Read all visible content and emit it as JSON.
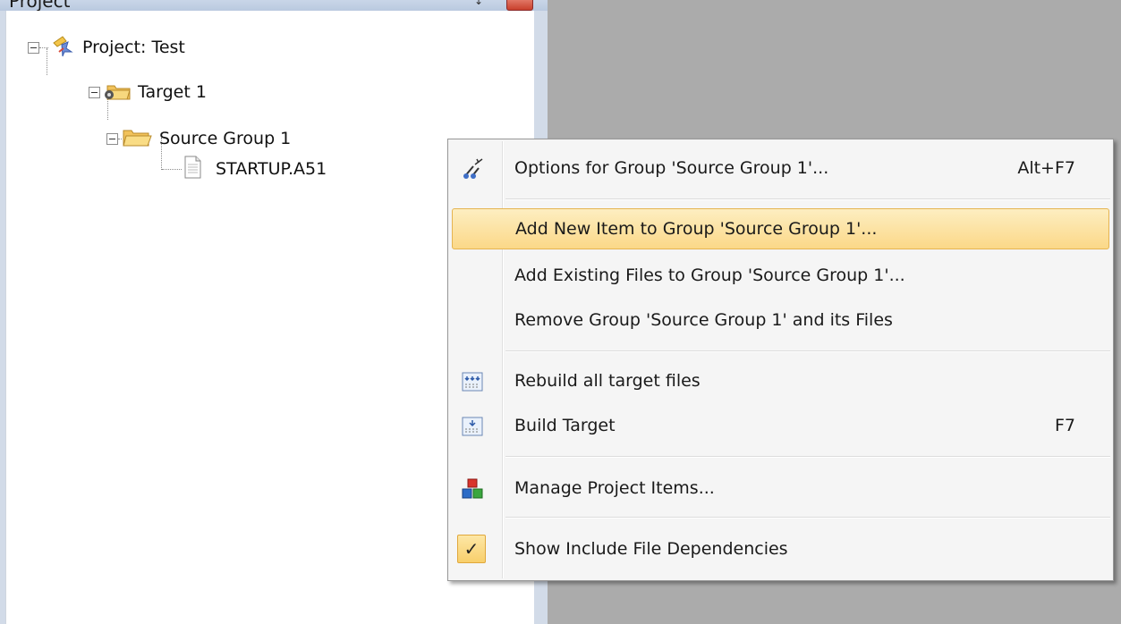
{
  "panel": {
    "title": "Project"
  },
  "tree": {
    "project_label": "Project: Test",
    "target_label": "Target 1",
    "group_label": "Source Group 1",
    "file_label": "STARTUP.A51"
  },
  "menu": {
    "items": [
      {
        "label": "Options for Group 'Source Group 1'...",
        "shortcut": "Alt+F7",
        "icon": "group-options-icon"
      },
      {
        "label": "Add New  Item to Group 'Source Group 1'...",
        "shortcut": "",
        "icon": ""
      },
      {
        "label": "Add Existing Files to Group 'Source Group 1'...",
        "shortcut": "",
        "icon": ""
      },
      {
        "label": "Remove Group 'Source Group 1' and its Files",
        "shortcut": "",
        "icon": ""
      },
      {
        "label": "Rebuild all target files",
        "shortcut": "",
        "icon": "rebuild-icon"
      },
      {
        "label": "Build Target",
        "shortcut": "F7",
        "icon": "build-icon"
      },
      {
        "label": "Manage Project Items...",
        "shortcut": "",
        "icon": "manage-items-icon"
      },
      {
        "label": "Show Include File Dependencies",
        "shortcut": "",
        "icon": "checkmark-icon",
        "checked": true
      }
    ],
    "highlighted_index": 1
  },
  "colors": {
    "highlight_top": "#fdeec1",
    "highlight_bottom": "#fbd888",
    "background": "#ababab"
  }
}
